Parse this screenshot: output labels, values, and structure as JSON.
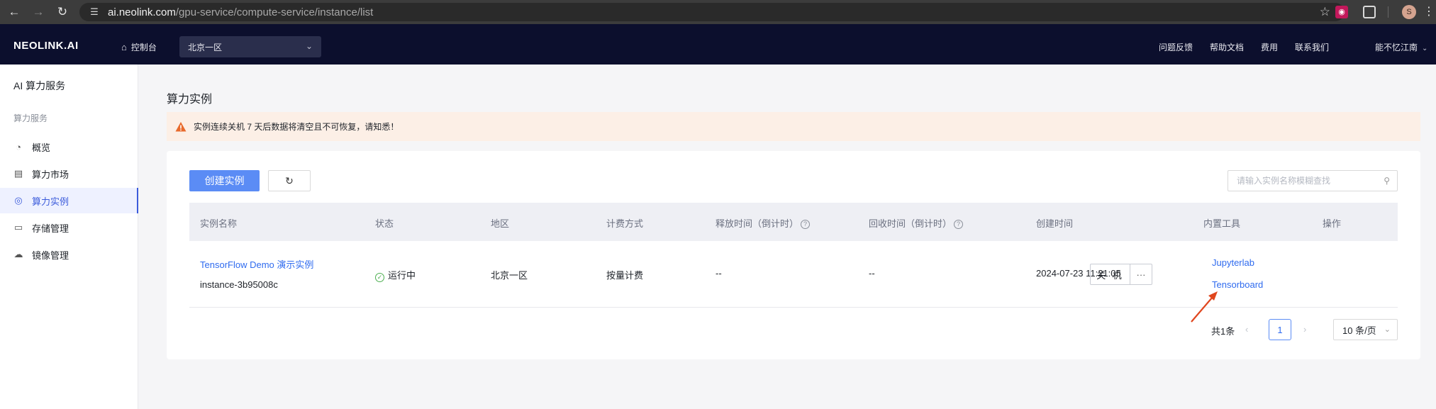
{
  "browser": {
    "url_host": "ai.neolink.com",
    "url_path": "/gpu-service/compute-service/instance/list",
    "profile_initial": "S",
    "icons": [
      "back-icon",
      "forward-icon",
      "reload-icon",
      "site-settings-icon",
      "bookmark-star-icon",
      "extension-icon",
      "puzzle-icon",
      "kebab-menu-icon"
    ]
  },
  "header": {
    "logo": "NEOLINK.AI",
    "console": "控制台",
    "region": "北京一区",
    "links": [
      "问题反馈",
      "帮助文档",
      "费用",
      "联系我们"
    ],
    "user": "能不忆江南"
  },
  "sidebar": {
    "title": "AI 算力服务",
    "group": "算力服务",
    "items": [
      {
        "label": "概览",
        "icon": "dashboard-icon"
      },
      {
        "label": "算力市场",
        "icon": "market-icon"
      },
      {
        "label": "算力实例",
        "icon": "instance-icon",
        "active": true
      },
      {
        "label": "存储管理",
        "icon": "storage-icon"
      },
      {
        "label": "镜像管理",
        "icon": "image-icon"
      }
    ]
  },
  "main": {
    "title": "算力实例",
    "alert": "实例连续关机 7 天后数据将清空且不可恢复，请知悉！",
    "create_button": "创建实例",
    "search_placeholder": "请输入实例名称模糊查找",
    "columns": [
      "实例名称",
      "状态",
      "地区",
      "计费方式",
      "释放时间（倒计时）",
      "回收时间（倒计时）",
      "创建时间",
      "内置工具",
      "操作"
    ],
    "rows": [
      {
        "name": "TensorFlow Demo 演示实例",
        "id": "instance-3b95008c",
        "status": "运行中",
        "region": "北京一区",
        "billing": "按量计费",
        "release": "--",
        "recycle": "--",
        "created": "2024-07-23 11:21:05",
        "tools": [
          "Jupyterlab",
          "Tensorboard"
        ],
        "action": "关 机",
        "more": "···"
      }
    ],
    "pager": {
      "total": "共1条",
      "page": "1",
      "page_size": "10 条/页"
    }
  },
  "colors": {
    "primary": "#5b8cf5",
    "link": "#2f6bef",
    "header_bg": "#0c0f2d",
    "alert_bg": "#fcefe6",
    "annotation_arrow": "#e0461e",
    "status_ok": "#4caf50"
  }
}
